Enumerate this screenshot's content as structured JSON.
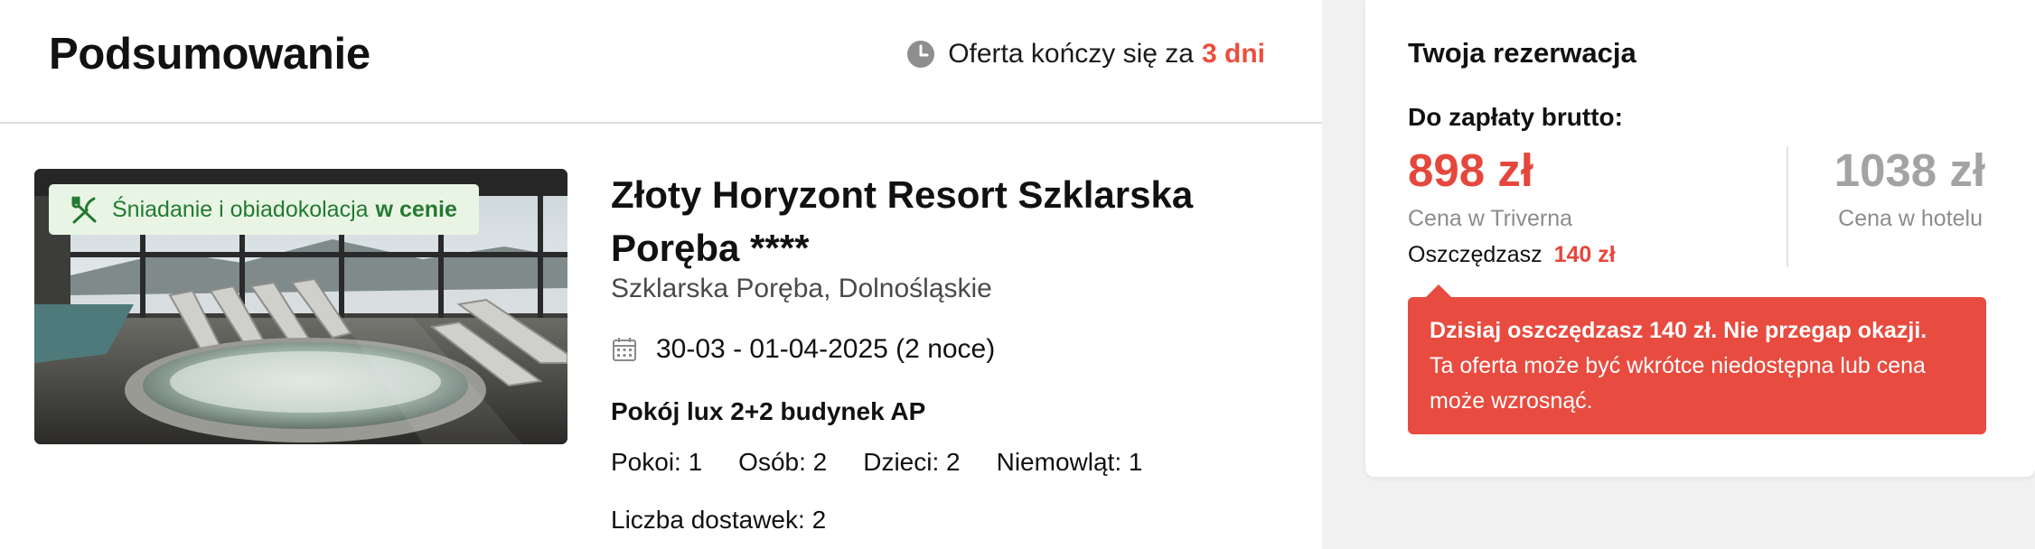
{
  "summary": {
    "title": "Podsumowanie",
    "offer_timer": {
      "icon": "clock-icon",
      "prefix": "Oferta kończy się za",
      "days": "3 dni",
      "highlight_color": "#ea4f3d"
    }
  },
  "hotel": {
    "meal_badge": {
      "icon": "fork-knife-icon",
      "text": "Śniadanie i obiadokolacja",
      "strong": "w cenie"
    },
    "name": "Złoty Horyzont Resort Szklarska Poręba ****",
    "location": "Szklarska Poręba, Dolnośląskie",
    "dates": "30-03 - 01-04-2025 (2 noce)",
    "room": "Pokój lux 2+2 budynek AP",
    "occupancy": {
      "rooms": "Pokoi: 1",
      "persons": "Osób: 2",
      "children": "Dzieci: 2",
      "infants": "Niemowląt: 1"
    },
    "extra_beds": "Liczba dostawek: 2"
  },
  "reservation": {
    "title": "Twoja rezerwacja",
    "pay_label": "Do zapłaty brutto:",
    "price_triverna": "898 zł",
    "price_triverna_label": "Cena w Triverna",
    "savings_label": "Oszczędzasz",
    "savings_amount": "140 zł",
    "price_hotel": "1038 zł",
    "price_hotel_label": "Cena w hotelu",
    "alert": {
      "headline": "Dzisiaj oszczędzasz 140 zł. Nie przegap okazji.",
      "body": "Ta oferta może być wkrótce niedostępna lub cena może wzrosnąć."
    },
    "colors": {
      "accent_red": "#e5473c",
      "muted_gray": "#a3a3a3"
    }
  }
}
